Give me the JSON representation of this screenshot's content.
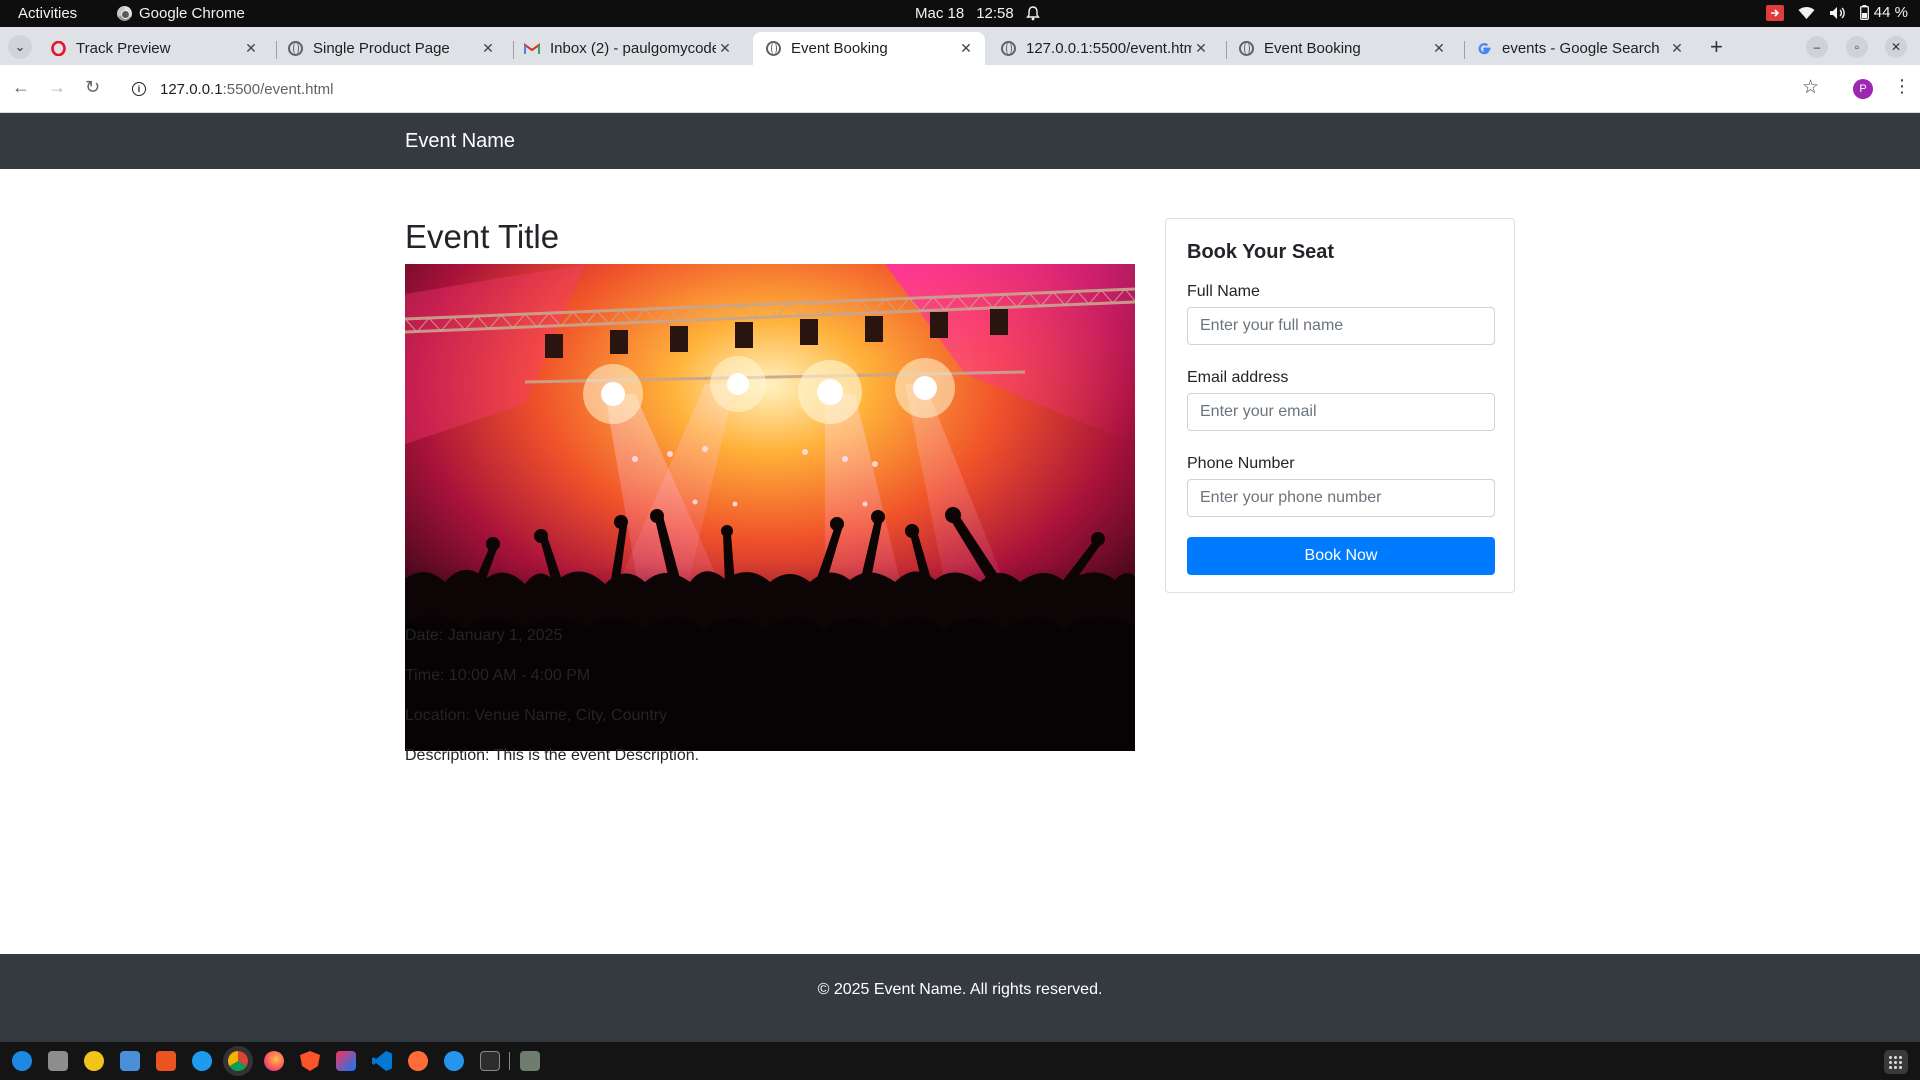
{
  "system_bar": {
    "activities": "Activities",
    "app_name": "Google Chrome",
    "date": "Mac 18",
    "time": "12:58",
    "battery": "44 %"
  },
  "browser": {
    "tabs": [
      {
        "title": "Track Preview",
        "icon": "opera-icon"
      },
      {
        "title": "Single Product Page",
        "icon": "globe-icon"
      },
      {
        "title": "Inbox (2) - paulgomycode",
        "icon": "gmail-icon"
      },
      {
        "title": "Event Booking",
        "icon": "globe-icon",
        "active": true
      },
      {
        "title": "127.0.0.1:5500/event.html",
        "icon": "globe-icon"
      },
      {
        "title": "Event Booking",
        "icon": "globe-icon"
      },
      {
        "title": "events - Google Search",
        "icon": "google-icon"
      }
    ],
    "url_host": "127.0.0.1",
    "url_path": ":5500/event.html",
    "profile_initial": "P"
  },
  "page": {
    "brand": "Event Name",
    "event_title": "Event Title",
    "details": {
      "date": "Date: January 1, 2025",
      "time": "Time: 10:00 AM - 4:00 PM",
      "location": "Location: Venue Name, City, Country",
      "description": "Description: This is the event Description."
    },
    "booking": {
      "title": "Book Your Seat",
      "name_label": "Full Name",
      "name_placeholder": "Enter your full name",
      "email_label": "Email address",
      "email_placeholder": "Enter your email",
      "phone_label": "Phone Number",
      "phone_placeholder": "Enter your phone number",
      "button": "Book Now"
    },
    "footer": "© 2025 Event Name. All rights reserved."
  },
  "colors": {
    "navbar": "#343a40",
    "primary_button": "#007bff"
  }
}
